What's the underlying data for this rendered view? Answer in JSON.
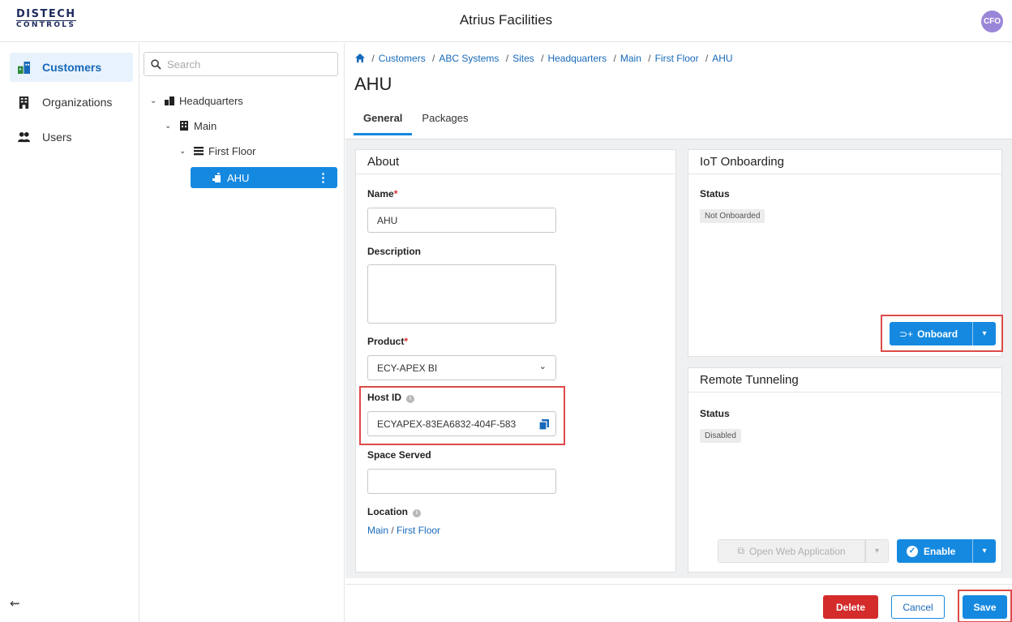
{
  "header": {
    "logo_line1": "DISTECH",
    "logo_line2": "CONTROLS",
    "app_title": "Atrius Facilities",
    "avatar_initials": "CFO"
  },
  "nav": {
    "items": [
      {
        "label": "Customers",
        "icon": "building-blocks-icon",
        "active": true
      },
      {
        "label": "Organizations",
        "icon": "office-building-icon",
        "active": false
      },
      {
        "label": "Users",
        "icon": "users-icon",
        "active": false
      }
    ],
    "collapse_icon": "collapse-left-arrow-icon"
  },
  "tree": {
    "search_placeholder": "Search",
    "nodes": [
      {
        "label": "Headquarters",
        "icon": "site-icon",
        "expanded": true
      },
      {
        "label": "Main",
        "icon": "building-icon",
        "expanded": true
      },
      {
        "label": "First Floor",
        "icon": "floor-stack-icon",
        "expanded": true
      },
      {
        "label": "AHU",
        "icon": "device-icon",
        "selected": true
      }
    ]
  },
  "breadcrumb": {
    "home_icon": "home-icon",
    "items": [
      "Customers",
      "ABC Systems",
      "Sites",
      "Headquarters",
      "Main",
      "First Floor",
      "AHU"
    ]
  },
  "page": {
    "title": "AHU",
    "tabs": [
      {
        "label": "General",
        "active": true
      },
      {
        "label": "Packages",
        "active": false
      }
    ]
  },
  "about": {
    "title": "About",
    "name_label": "Name",
    "name_value": "AHU",
    "description_label": "Description",
    "description_value": "",
    "product_label": "Product",
    "product_value": "ECY-APEX BI",
    "host_id_label": "Host ID",
    "host_id_value": "ECYAPEX-83EA6832-404F-583",
    "space_served_label": "Space Served",
    "space_served_value": "",
    "location_label": "Location",
    "location_main": "Main",
    "location_sep": "/",
    "location_floor": "First Floor",
    "required_mark": "*",
    "info_glyph": "i"
  },
  "iot": {
    "title": "IoT Onboarding",
    "status_label": "Status",
    "status_value": "Not Onboarded",
    "onboard_label": "Onboard"
  },
  "tunnel": {
    "title": "Remote Tunneling",
    "status_label": "Status",
    "status_value": "Disabled",
    "open_web_label": "Open Web Application",
    "enable_label": "Enable"
  },
  "footer": {
    "delete_label": "Delete",
    "cancel_label": "Cancel",
    "save_label": "Save"
  },
  "colors": {
    "accent": "#1589e0",
    "danger": "#d42b2b",
    "highlight_box": "#dd4b48",
    "avatar": "#9a86d9"
  }
}
